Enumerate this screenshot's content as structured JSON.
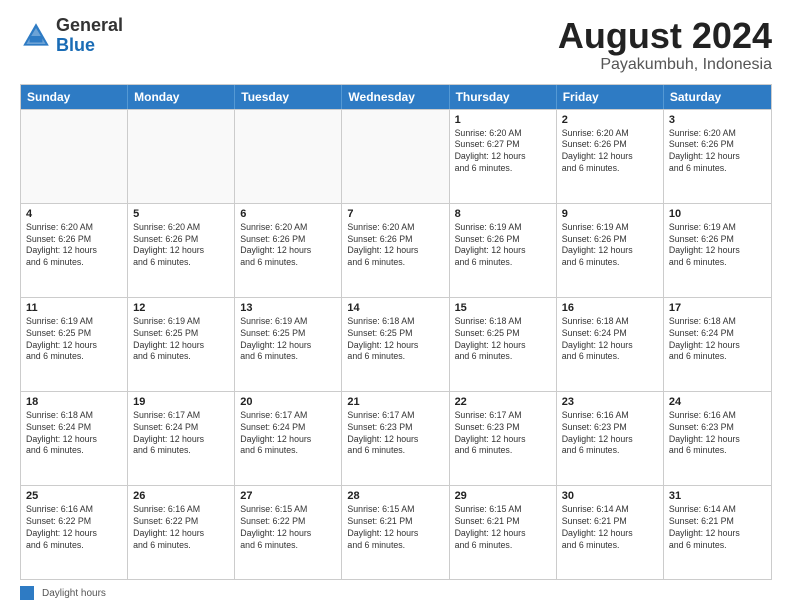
{
  "header": {
    "logo_general": "General",
    "logo_blue": "Blue",
    "month_year": "August 2024",
    "location": "Payakumbuh, Indonesia"
  },
  "calendar": {
    "days_of_week": [
      "Sunday",
      "Monday",
      "Tuesday",
      "Wednesday",
      "Thursday",
      "Friday",
      "Saturday"
    ],
    "rows": [
      [
        {
          "day": "",
          "info": ""
        },
        {
          "day": "",
          "info": ""
        },
        {
          "day": "",
          "info": ""
        },
        {
          "day": "",
          "info": ""
        },
        {
          "day": "1",
          "info": "Sunrise: 6:20 AM\nSunset: 6:27 PM\nDaylight: 12 hours\nand 6 minutes."
        },
        {
          "day": "2",
          "info": "Sunrise: 6:20 AM\nSunset: 6:26 PM\nDaylight: 12 hours\nand 6 minutes."
        },
        {
          "day": "3",
          "info": "Sunrise: 6:20 AM\nSunset: 6:26 PM\nDaylight: 12 hours\nand 6 minutes."
        }
      ],
      [
        {
          "day": "4",
          "info": "Sunrise: 6:20 AM\nSunset: 6:26 PM\nDaylight: 12 hours\nand 6 minutes."
        },
        {
          "day": "5",
          "info": "Sunrise: 6:20 AM\nSunset: 6:26 PM\nDaylight: 12 hours\nand 6 minutes."
        },
        {
          "day": "6",
          "info": "Sunrise: 6:20 AM\nSunset: 6:26 PM\nDaylight: 12 hours\nand 6 minutes."
        },
        {
          "day": "7",
          "info": "Sunrise: 6:20 AM\nSunset: 6:26 PM\nDaylight: 12 hours\nand 6 minutes."
        },
        {
          "day": "8",
          "info": "Sunrise: 6:19 AM\nSunset: 6:26 PM\nDaylight: 12 hours\nand 6 minutes."
        },
        {
          "day": "9",
          "info": "Sunrise: 6:19 AM\nSunset: 6:26 PM\nDaylight: 12 hours\nand 6 minutes."
        },
        {
          "day": "10",
          "info": "Sunrise: 6:19 AM\nSunset: 6:26 PM\nDaylight: 12 hours\nand 6 minutes."
        }
      ],
      [
        {
          "day": "11",
          "info": "Sunrise: 6:19 AM\nSunset: 6:25 PM\nDaylight: 12 hours\nand 6 minutes."
        },
        {
          "day": "12",
          "info": "Sunrise: 6:19 AM\nSunset: 6:25 PM\nDaylight: 12 hours\nand 6 minutes."
        },
        {
          "day": "13",
          "info": "Sunrise: 6:19 AM\nSunset: 6:25 PM\nDaylight: 12 hours\nand 6 minutes."
        },
        {
          "day": "14",
          "info": "Sunrise: 6:18 AM\nSunset: 6:25 PM\nDaylight: 12 hours\nand 6 minutes."
        },
        {
          "day": "15",
          "info": "Sunrise: 6:18 AM\nSunset: 6:25 PM\nDaylight: 12 hours\nand 6 minutes."
        },
        {
          "day": "16",
          "info": "Sunrise: 6:18 AM\nSunset: 6:24 PM\nDaylight: 12 hours\nand 6 minutes."
        },
        {
          "day": "17",
          "info": "Sunrise: 6:18 AM\nSunset: 6:24 PM\nDaylight: 12 hours\nand 6 minutes."
        }
      ],
      [
        {
          "day": "18",
          "info": "Sunrise: 6:18 AM\nSunset: 6:24 PM\nDaylight: 12 hours\nand 6 minutes."
        },
        {
          "day": "19",
          "info": "Sunrise: 6:17 AM\nSunset: 6:24 PM\nDaylight: 12 hours\nand 6 minutes."
        },
        {
          "day": "20",
          "info": "Sunrise: 6:17 AM\nSunset: 6:24 PM\nDaylight: 12 hours\nand 6 minutes."
        },
        {
          "day": "21",
          "info": "Sunrise: 6:17 AM\nSunset: 6:23 PM\nDaylight: 12 hours\nand 6 minutes."
        },
        {
          "day": "22",
          "info": "Sunrise: 6:17 AM\nSunset: 6:23 PM\nDaylight: 12 hours\nand 6 minutes."
        },
        {
          "day": "23",
          "info": "Sunrise: 6:16 AM\nSunset: 6:23 PM\nDaylight: 12 hours\nand 6 minutes."
        },
        {
          "day": "24",
          "info": "Sunrise: 6:16 AM\nSunset: 6:23 PM\nDaylight: 12 hours\nand 6 minutes."
        }
      ],
      [
        {
          "day": "25",
          "info": "Sunrise: 6:16 AM\nSunset: 6:22 PM\nDaylight: 12 hours\nand 6 minutes."
        },
        {
          "day": "26",
          "info": "Sunrise: 6:16 AM\nSunset: 6:22 PM\nDaylight: 12 hours\nand 6 minutes."
        },
        {
          "day": "27",
          "info": "Sunrise: 6:15 AM\nSunset: 6:22 PM\nDaylight: 12 hours\nand 6 minutes."
        },
        {
          "day": "28",
          "info": "Sunrise: 6:15 AM\nSunset: 6:21 PM\nDaylight: 12 hours\nand 6 minutes."
        },
        {
          "day": "29",
          "info": "Sunrise: 6:15 AM\nSunset: 6:21 PM\nDaylight: 12 hours\nand 6 minutes."
        },
        {
          "day": "30",
          "info": "Sunrise: 6:14 AM\nSunset: 6:21 PM\nDaylight: 12 hours\nand 6 minutes."
        },
        {
          "day": "31",
          "info": "Sunrise: 6:14 AM\nSunset: 6:21 PM\nDaylight: 12 hours\nand 6 minutes."
        }
      ]
    ]
  },
  "footer": {
    "daylight_label": "Daylight hours"
  }
}
